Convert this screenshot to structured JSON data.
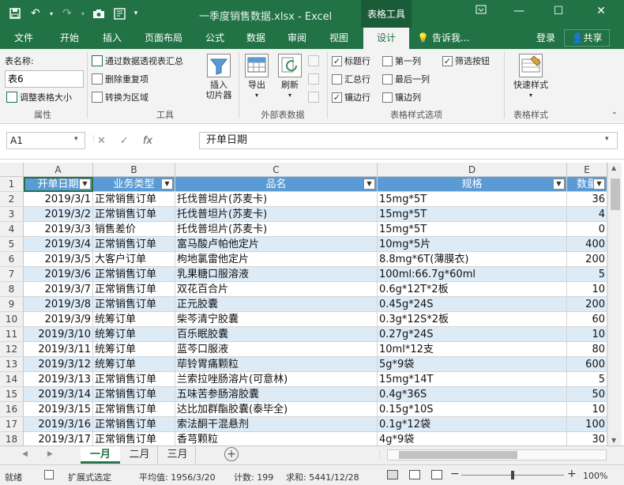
{
  "window": {
    "title": "一季度销售数据.xlsx - Excel",
    "context_tab": "表格工具"
  },
  "tabs": [
    "文件",
    "开始",
    "插入",
    "页面布局",
    "公式",
    "数据",
    "审阅",
    "视图",
    "设计"
  ],
  "tell_me": "告诉我...",
  "login": "登录",
  "share": "共享",
  "ribbon": {
    "props": {
      "label_name": "表名称:",
      "table_name": "表6",
      "resize": "调整表格大小",
      "group": "属性"
    },
    "tools": {
      "pivot": "通过数据透视表汇总",
      "dedupe": "删除重复项",
      "convert": "转换为区域",
      "slicer": "插入\n切片器",
      "group": "工具"
    },
    "external": {
      "export": "导出",
      "refresh": "刷新",
      "group": "外部表数据"
    },
    "style_opts": {
      "header_row": "标题行",
      "first_col": "第一列",
      "filter_btn": "筛选按钮",
      "total_row": "汇总行",
      "last_col": "最后一列",
      "banded_rows": "镶边行",
      "banded_cols": "镶边列",
      "group": "表格样式选项"
    },
    "styles": {
      "quick": "快速样式",
      "group": "表格样式"
    }
  },
  "namebox": "A1",
  "formula": "开单日期",
  "columns": [
    "A",
    "B",
    "C",
    "D",
    "E"
  ],
  "headers": [
    "开单日期",
    "业务类型",
    "品名",
    "规格",
    "数量"
  ],
  "rows": [
    [
      "2019/3/1",
      "正常销售订单",
      "托伐普坦片(苏麦卡)",
      "15mg*5T",
      "36"
    ],
    [
      "2019/3/2",
      "正常销售订单",
      "托伐普坦片(苏麦卡)",
      "15mg*5T",
      "4"
    ],
    [
      "2019/3/3",
      "销售差价",
      "托伐普坦片(苏麦卡)",
      "15mg*5T",
      "0"
    ],
    [
      "2019/3/4",
      "正常销售订单",
      "富马酸卢帕他定片",
      "10mg*5片",
      "400"
    ],
    [
      "2019/3/5",
      "大客户订单",
      "枸地氯雷他定片",
      "8.8mg*6T(薄膜衣)",
      "200"
    ],
    [
      "2019/3/6",
      "正常销售订单",
      "乳果糖口服溶液",
      "100ml:66.7g*60ml",
      "5"
    ],
    [
      "2019/3/7",
      "正常销售订单",
      "双花百合片",
      "0.6g*12T*2板",
      "10"
    ],
    [
      "2019/3/8",
      "正常销售订单",
      "正元胶囊",
      "0.45g*24S",
      "200"
    ],
    [
      "2019/3/9",
      "统筹订单",
      "柴芩清宁胶囊",
      "0.3g*12S*2板",
      "60"
    ],
    [
      "2019/3/10",
      "统筹订单",
      "百乐眠胶囊",
      "0.27g*24S",
      "10"
    ],
    [
      "2019/3/11",
      "统筹订单",
      "蓝芩口服液",
      "10ml*12支",
      "80"
    ],
    [
      "2019/3/12",
      "统筹订单",
      "荜铃胃痛颗粒",
      "5g*9袋",
      "600"
    ],
    [
      "2019/3/13",
      "正常销售订单",
      "兰索拉唑肠溶片(可意林)",
      "15mg*14T",
      "5"
    ],
    [
      "2019/3/14",
      "正常销售订单",
      "五味苦参肠溶胶囊",
      "0.4g*36S",
      "50"
    ],
    [
      "2019/3/15",
      "正常销售订单",
      "达比加群酯胶囊(泰毕全)",
      "0.15g*10S",
      "10"
    ],
    [
      "2019/3/16",
      "正常销售订单",
      "索法酮干混悬剂",
      "0.1g*12袋",
      "100"
    ],
    [
      "2019/3/17",
      "正常销售订单",
      "香芎颗粒",
      "4g*9袋",
      "30"
    ]
  ],
  "sheets": [
    "一月",
    "二月",
    "三月"
  ],
  "status": {
    "ready": "就绪",
    "mode": "扩展式选定",
    "avg": "平均值: 1956/3/20",
    "count": "计数: 199",
    "sum": "求和: 5441/12/28",
    "zoom": "100%"
  }
}
